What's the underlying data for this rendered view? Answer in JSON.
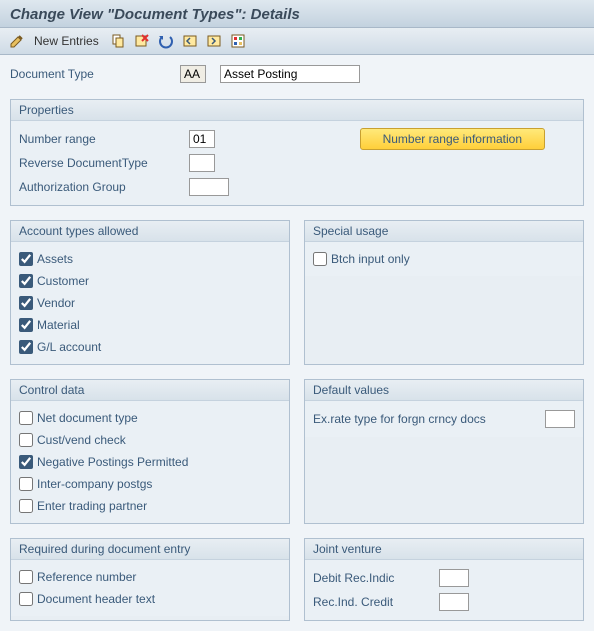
{
  "title": "Change View \"Document Types\": Details",
  "toolbar": {
    "new_entries": "New Entries"
  },
  "doc_type": {
    "label": "Document Type",
    "code": "AA",
    "desc": "Asset Posting"
  },
  "properties": {
    "title": "Properties",
    "number_range_label": "Number range",
    "number_range": "01",
    "reverse_label": "Reverse DocumentType",
    "reverse": "",
    "auth_label": "Authorization Group",
    "auth": "",
    "nr_info_button": "Number range information"
  },
  "account_types": {
    "title": "Account types allowed",
    "items": [
      {
        "label": "Assets",
        "checked": true
      },
      {
        "label": "Customer",
        "checked": true
      },
      {
        "label": "Vendor",
        "checked": true
      },
      {
        "label": "Material",
        "checked": true
      },
      {
        "label": "G/L account",
        "checked": true
      }
    ]
  },
  "special_usage": {
    "title": "Special usage",
    "items": [
      {
        "label": "Btch input only",
        "checked": false
      }
    ]
  },
  "control_data": {
    "title": "Control data",
    "items": [
      {
        "label": "Net document type",
        "checked": false
      },
      {
        "label": "Cust/vend check",
        "checked": false
      },
      {
        "label": "Negative Postings Permitted",
        "checked": true
      },
      {
        "label": "Inter-company postgs",
        "checked": false
      },
      {
        "label": "Enter trading partner",
        "checked": false
      }
    ]
  },
  "default_values": {
    "title": "Default values",
    "ex_rate_label": "Ex.rate type for forgn crncy docs",
    "ex_rate": ""
  },
  "required": {
    "title": "Required during document entry",
    "items": [
      {
        "label": "Reference number",
        "checked": false
      },
      {
        "label": "Document header text",
        "checked": false
      }
    ]
  },
  "joint_venture": {
    "title": "Joint venture",
    "debit_label": "Debit Rec.Indic",
    "debit": "",
    "credit_label": "Rec.Ind. Credit",
    "credit": ""
  }
}
